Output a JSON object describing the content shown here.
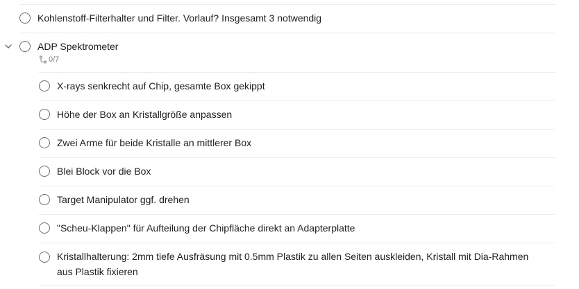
{
  "tasks": [
    {
      "label": "Kohlenstoff-Filterhalter und Filter. Vorlauf? Insgesamt 3 notwendig"
    },
    {
      "label": "ADP Spektrometer",
      "subtask_count": "0/7"
    }
  ],
  "subtasks": [
    {
      "label": "X-rays senkrecht auf Chip, gesamte Box gekippt"
    },
    {
      "label": "Höhe der Box an Kristallgröße anpassen"
    },
    {
      "label": "Zwei Arme für beide Kristalle an mittlerer Box"
    },
    {
      "label": "Blei Block vor die Box"
    },
    {
      "label": "Target Manipulator ggf. drehen"
    },
    {
      "label": "\"Scheu-Klappen\" für Aufteilung der Chipfläche direkt an Adapterplatte"
    },
    {
      "label": "Kristallhalterung: 2mm tiefe Ausfräsung mit 0.5mm Plastik zu allen Seiten auskleiden, Kristall mit Dia-Rahmen aus Plastik fixieren"
    }
  ],
  "icons": {
    "chevron": "chevron-down-icon",
    "subtask": "subtask-branch-icon",
    "checkbox": "checkbox-circle-icon"
  }
}
